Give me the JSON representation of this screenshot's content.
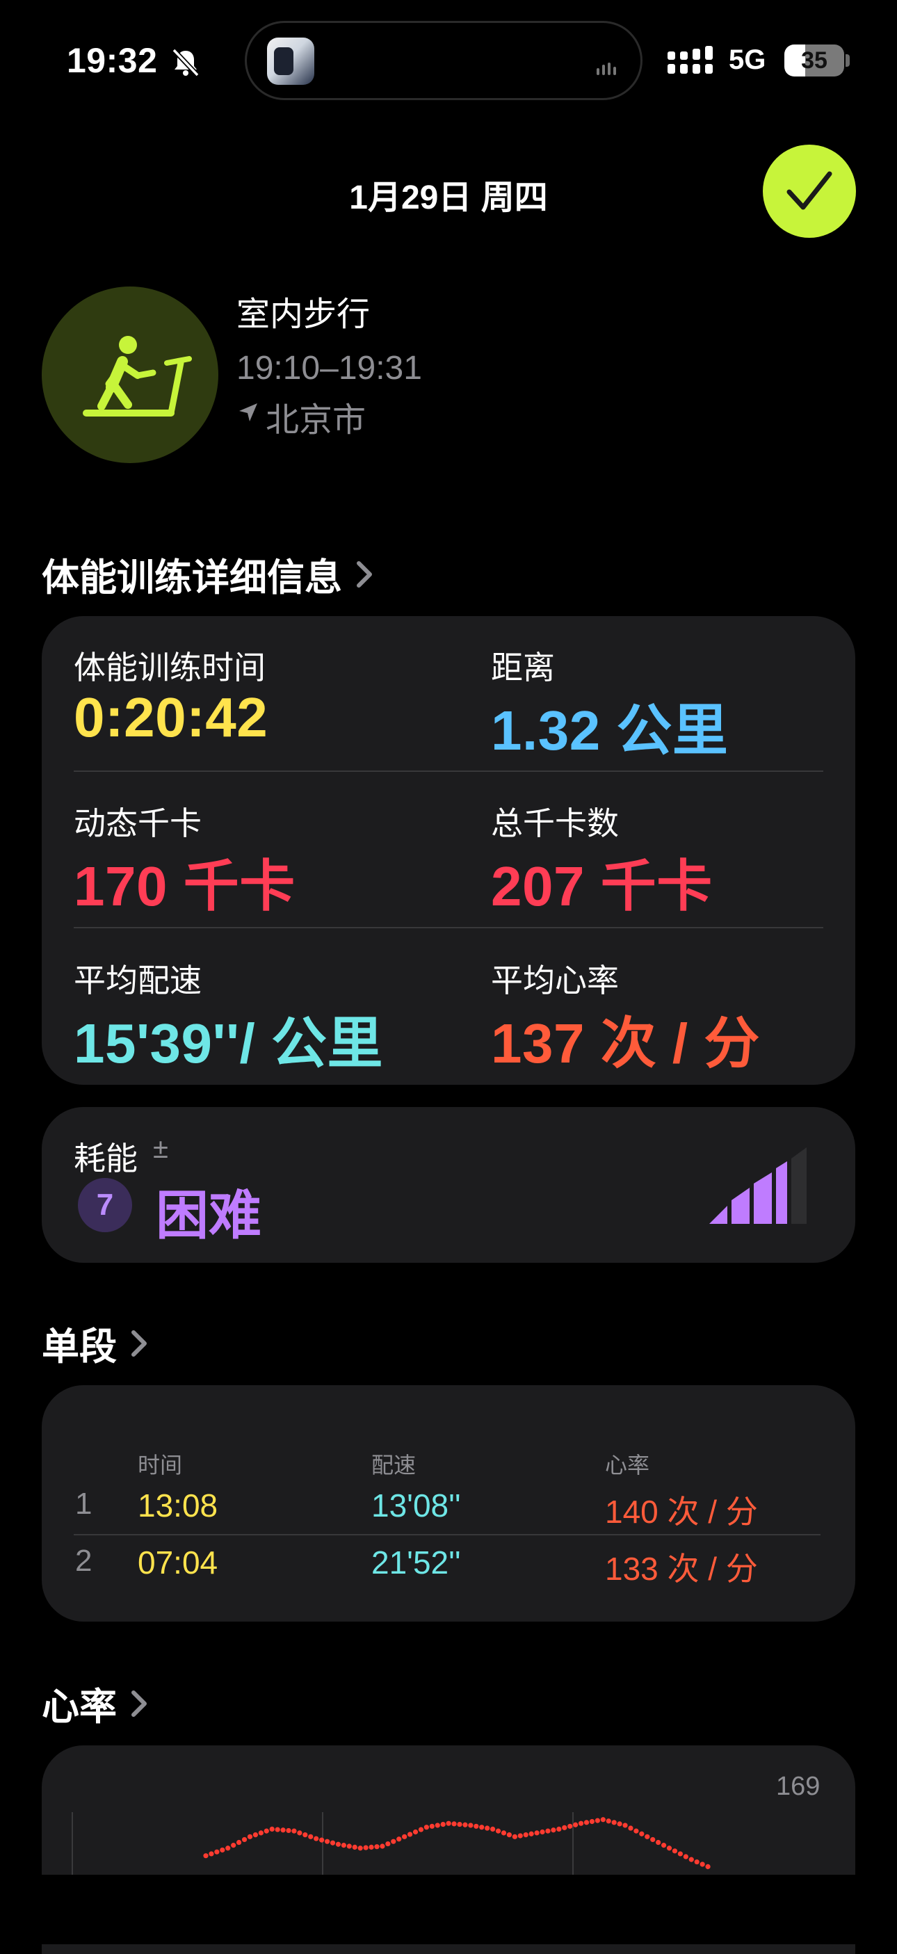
{
  "status_bar": {
    "time": "19:32",
    "network": "5G",
    "battery": "35"
  },
  "header": {
    "date": "1月29日 周四"
  },
  "workout": {
    "name": "室内步行",
    "time_range": "19:10–19:31",
    "location": "北京市"
  },
  "details": {
    "heading": "体能训练详细信息",
    "metrics": [
      {
        "label": "体能训练时间",
        "value": "0:20:42",
        "color": "#ffe34d"
      },
      {
        "label": "距离",
        "value": "1.32 公里",
        "color": "#5ac2ff"
      },
      {
        "label": "动态千卡",
        "value": "170 千卡",
        "color": "#ff3d55"
      },
      {
        "label": "总千卡数",
        "value": "207 千卡",
        "color": "#ff3d55"
      },
      {
        "label": "平均配速",
        "value": "15'39''/ 公里",
        "color": "#6ee6e6"
      },
      {
        "label": "平均心率",
        "value": "137 次 / 分",
        "color": "#ff5b3a"
      }
    ]
  },
  "effort": {
    "label": "耗能",
    "pm": "±",
    "level": "7",
    "value": "困难",
    "bars_filled_of_total": [
      4,
      5
    ],
    "color": "#bf7cff"
  },
  "splits": {
    "heading": "单段",
    "columns": [
      "时间",
      "配速",
      "心率"
    ],
    "rows": [
      {
        "num": "1",
        "time": "13:08",
        "pace": "13'08''",
        "hr": "140 次 / 分"
      },
      {
        "num": "2",
        "time": "07:04",
        "pace": "21'52''",
        "hr": "133 次 / 分"
      }
    ]
  },
  "heart_rate": {
    "heading": "心率",
    "max_label": "169",
    "line_color": "#ff3b30",
    "chart_data": {
      "type": "line",
      "series": [
        {
          "values": [
            120,
            124,
            130,
            134,
            133,
            129,
            126,
            124,
            125,
            130,
            135,
            137,
            136,
            134,
            130,
            132,
            134,
            137,
            139,
            136,
            130,
            124,
            118,
            113
          ]
        }
      ],
      "ylim_max": 169
    }
  }
}
